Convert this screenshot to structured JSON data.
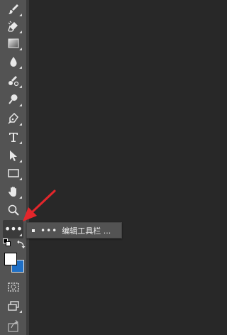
{
  "toolbar": {
    "tools": [
      {
        "name": "brush-icon",
        "icon": "brush"
      },
      {
        "name": "eraser-icon",
        "icon": "eraser"
      },
      {
        "name": "gradient-icon",
        "icon": "gradient"
      },
      {
        "name": "blur-drop-icon",
        "icon": "drop"
      },
      {
        "name": "smudge-icon",
        "icon": "smudge"
      },
      {
        "name": "dodge-icon",
        "icon": "dodge"
      },
      {
        "name": "pen-icon",
        "icon": "pen"
      },
      {
        "name": "type-icon",
        "icon": "type"
      },
      {
        "name": "path-select-icon",
        "icon": "arrow"
      },
      {
        "name": "rectangle-icon",
        "icon": "rect"
      },
      {
        "name": "hand-icon",
        "icon": "hand"
      },
      {
        "name": "zoom-icon",
        "icon": "zoom"
      }
    ],
    "more_tools_dots": "•••"
  },
  "flyout": {
    "dots": "•••",
    "label": "编辑工具栏 ..."
  },
  "colors": {
    "foreground": "#ffffff",
    "background": "#1f6fc5",
    "arrow": "#e3262b"
  }
}
